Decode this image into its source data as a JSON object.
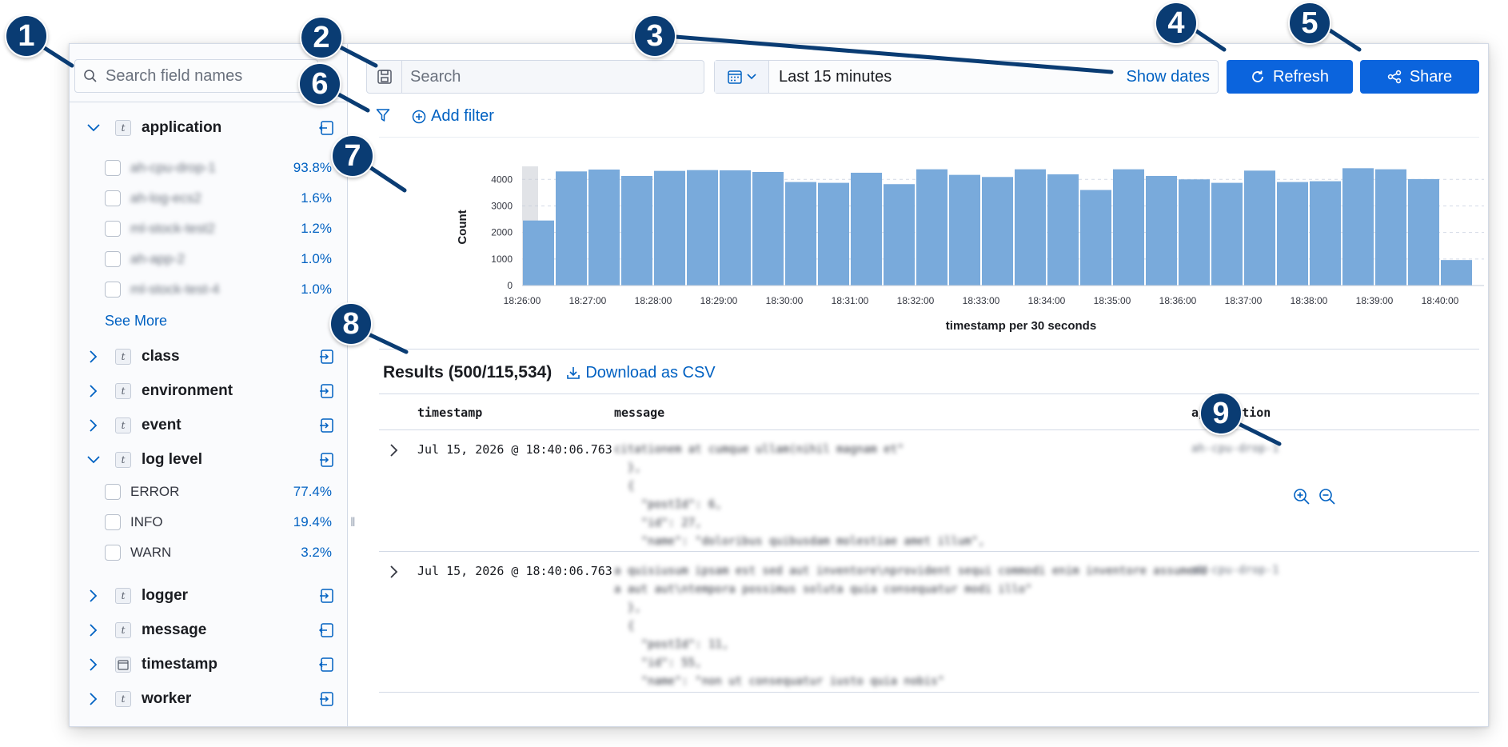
{
  "sidebar": {
    "search_placeholder": "Search field names",
    "fields": [
      {
        "name": "application",
        "type": "t",
        "expanded": true
      },
      {
        "name": "class",
        "type": "t",
        "expanded": false
      },
      {
        "name": "environment",
        "type": "t",
        "expanded": false
      },
      {
        "name": "event",
        "type": "t",
        "expanded": false
      },
      {
        "name": "log level",
        "type": "t",
        "expanded": true
      },
      {
        "name": "logger",
        "type": "t",
        "expanded": false
      },
      {
        "name": "message",
        "type": "t",
        "expanded": false
      },
      {
        "name": "timestamp",
        "type": "date",
        "expanded": false
      },
      {
        "name": "worker",
        "type": "t",
        "expanded": false
      }
    ],
    "application_values": [
      {
        "label": "ah-cpu-drop-1",
        "pct": "93.8%"
      },
      {
        "label": "ah-log-ecs2",
        "pct": "1.6%"
      },
      {
        "label": "ml-stock-test2",
        "pct": "1.2%"
      },
      {
        "label": "ah-app-2",
        "pct": "1.0%"
      },
      {
        "label": "ml-stock-test-4",
        "pct": "1.0%"
      }
    ],
    "see_more": "See More",
    "loglevel_values": [
      {
        "label": "ERROR",
        "pct": "77.4%"
      },
      {
        "label": "INFO",
        "pct": "19.4%"
      },
      {
        "label": "WARN",
        "pct": "3.2%"
      }
    ]
  },
  "toolbar": {
    "search_placeholder": "Search",
    "time_range": "Last 15 minutes",
    "show_dates": "Show dates",
    "refresh": "Refresh",
    "share": "Share",
    "add_filter": "Add filter"
  },
  "chart_data": {
    "type": "bar",
    "ylabel": "Count",
    "xlabel": "timestamp per 30 seconds",
    "ylim": [
      0,
      4400
    ],
    "yticks": [
      0,
      1000,
      2000,
      3000,
      4000
    ],
    "xticks": [
      "18:26:00",
      "18:27:00",
      "18:28:00",
      "18:29:00",
      "18:30:00",
      "18:31:00",
      "18:32:00",
      "18:33:00",
      "18:34:00",
      "18:35:00",
      "18:36:00",
      "18:37:00",
      "18:38:00",
      "18:39:00",
      "18:40:00"
    ],
    "values": [
      2450,
      4300,
      4370,
      4130,
      4320,
      4350,
      4340,
      4280,
      3900,
      3870,
      4250,
      3820,
      4380,
      4170,
      4090,
      4380,
      4190,
      3600,
      4380,
      4130,
      4000,
      3870,
      4330,
      3900,
      3930,
      4420,
      4380,
      4010,
      960
    ],
    "grid": true
  },
  "results": {
    "title": "Results (500/115,534)",
    "download": "Download as CSV",
    "columns": [
      "timestamp",
      "message",
      "application"
    ],
    "rows": [
      {
        "timestamp": "Jul 15, 2026 @ 18:40:06.763",
        "message": "citationem at cumque ullam(nihil magnam et\"\n  },\n  {\n    \"postId\": 6,\n    \"id\": 27,\n    \"name\": \"doloribus quibusdam molestiae amet illum\",\n    \"email\": \"Jake@example.org\"",
        "application": "ah-cpu-drop-1"
      },
      {
        "timestamp": "Jul 15, 2026 @ 18:40:06.763",
        "message": "a quisiusum ipsam est sed aut inventore\\nprovident sequi commodi enim inventore assumend\na aut aut\\ntempora possimus soluta quia consequatur modi illo\"\n  },\n  {\n    \"postId\": 11,\n    \"id\": 55,\n    \"name\": \"non ut consequatur iusto quia nobis\"",
        "application": "ah-cpu-drop-1"
      }
    ]
  },
  "callouts": [
    "1",
    "2",
    "3",
    "4",
    "5",
    "6",
    "7",
    "8",
    "9"
  ],
  "colors": {
    "accent": "#0b64dd",
    "bar": "#79aadb",
    "callout": "#0a3c73",
    "link": "#0061c2"
  }
}
